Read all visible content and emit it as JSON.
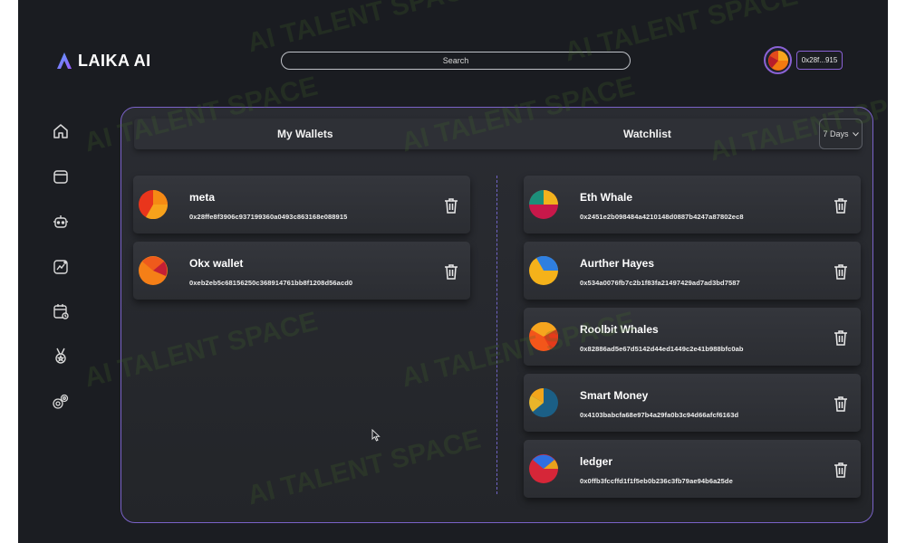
{
  "app": {
    "logo_text": "LAIKA AI"
  },
  "search": {
    "placeholder": "Search"
  },
  "account": {
    "address": "0x28f...915"
  },
  "sidebar": {
    "items": [
      {
        "icon": "home-icon"
      },
      {
        "icon": "wallet-icon"
      },
      {
        "icon": "chatbot-icon"
      },
      {
        "icon": "chart-icon"
      },
      {
        "icon": "calendar-icon"
      },
      {
        "icon": "medal-icon"
      },
      {
        "icon": "settings-icon"
      }
    ]
  },
  "panel": {
    "my_wallets_title": "My Wallets",
    "watchlist_title": "Watchlist",
    "range_select": "7 Days"
  },
  "wallets": [
    {
      "name": "meta",
      "address": "0x28ffe8f3906c937199360a0493c863168e088915"
    },
    {
      "name": "Okx wallet",
      "address": "0xeb2eb5c68156250c368914761bb8f1208d56acd0"
    }
  ],
  "watchlist": [
    {
      "name": "Eth Whale",
      "address": "0x2451e2b098484a4210148d0887b4247a87802ec8"
    },
    {
      "name": "Aurther Hayes",
      "address": "0x534a0076fb7c2b1f83fa21497429ad7ad3bd7587"
    },
    {
      "name": "Roolbit Whales",
      "address": "0x82886ad5e67d5142d44ed1449c2e41b988bfc0ab"
    },
    {
      "name": "Smart Money",
      "address": "0x4103babcfa68e97b4a29fa0b3c94d66afcf6163d"
    },
    {
      "name": "ledger",
      "address": "0x0ffb3fccffd1f1f5eb0b236c3fb79ae94b6a25de"
    }
  ],
  "watermark": {
    "text": "AI TALENT SPACE"
  },
  "colors": {
    "background": "#1b1d22",
    "panel_border": "#7a62c8",
    "accent": "#8a62d6"
  }
}
